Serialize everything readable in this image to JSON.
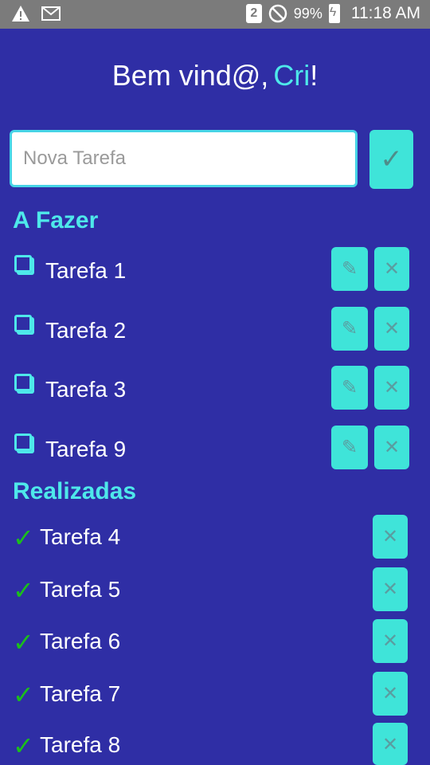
{
  "status_bar": {
    "left_icons": [
      "warning-icon",
      "mail-icon"
    ],
    "sim_label": "2",
    "battery_percent": "99%",
    "time": "11:18 AM"
  },
  "greeting": {
    "prefix": "Bem vind@,",
    "name": "Cri",
    "suffix": "!"
  },
  "new_task": {
    "value": "",
    "placeholder": "Nova Tarefa",
    "confirm_icon": "✓"
  },
  "sections": {
    "todo_title": "A Fazer",
    "done_title": "Realizadas"
  },
  "todo": [
    {
      "label": "Tarefa 1"
    },
    {
      "label": "Tarefa 2"
    },
    {
      "label": "Tarefa 3"
    },
    {
      "label": "Tarefa 9"
    }
  ],
  "done": [
    {
      "label": "Tarefa 4"
    },
    {
      "label": "Tarefa 5"
    },
    {
      "label": "Tarefa 6"
    },
    {
      "label": "Tarefa 7"
    },
    {
      "label": "Tarefa 8"
    }
  ],
  "icons": {
    "edit": "✎",
    "delete": "✕",
    "done": "✓"
  },
  "colors": {
    "background": "#2f2ea5",
    "accent": "#4ee8ea",
    "button": "#3fe4d9",
    "check_green": "#1bbf1b"
  }
}
